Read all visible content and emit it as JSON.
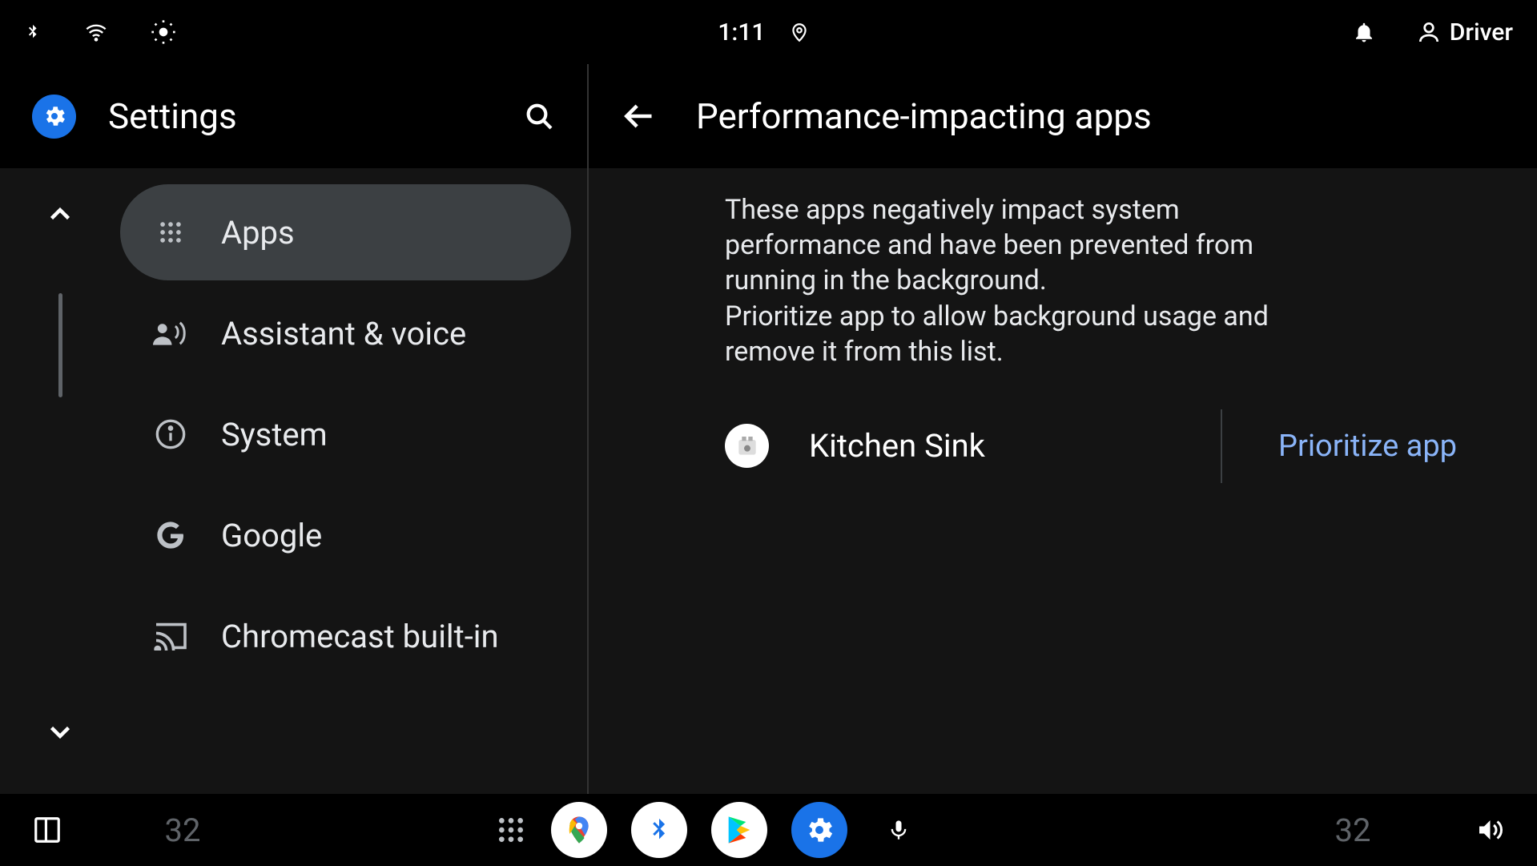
{
  "status": {
    "time": "1:11",
    "user_label": "Driver"
  },
  "sidebar": {
    "title": "Settings",
    "items": [
      {
        "label": "Apps",
        "icon": "apps-grid-icon",
        "selected": true
      },
      {
        "label": "Assistant & voice",
        "icon": "assistant-voice-icon",
        "selected": false
      },
      {
        "label": "System",
        "icon": "info-icon",
        "selected": false
      },
      {
        "label": "Google",
        "icon": "google-g-icon",
        "selected": false
      },
      {
        "label": "Chromecast built-in",
        "icon": "cast-icon",
        "selected": false
      }
    ]
  },
  "detail": {
    "title": "Performance-impacting apps",
    "description": "These apps negatively impact system performance and have been prevented from running in the background.\nPrioritize app to allow background usage and remove it from this list.",
    "apps": [
      {
        "name": "Kitchen Sink",
        "action_label": "Prioritize app"
      }
    ]
  },
  "dock": {
    "temperature_left": "32",
    "temperature_right": "32"
  },
  "colors": {
    "accent": "#1a73e8",
    "link": "#8ab4f8",
    "surface": "#141414",
    "selected": "#3c4043"
  }
}
